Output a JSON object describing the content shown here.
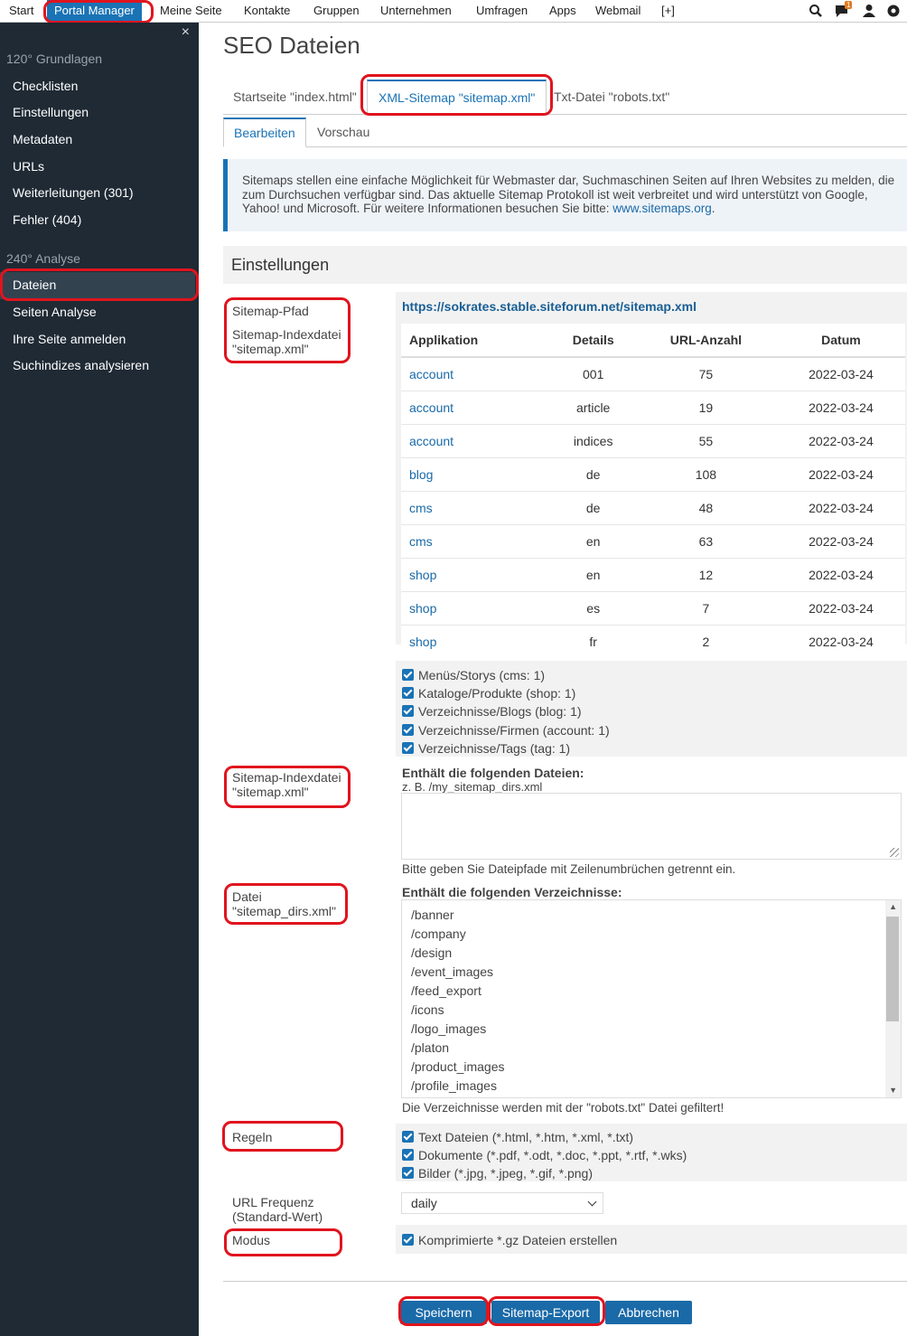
{
  "topnav": {
    "items": [
      "Start",
      "Portal Manager",
      "Meine Seite",
      "Kontakte",
      "Gruppen",
      "Unternehmen",
      "Umfragen",
      "Apps",
      "Webmail",
      "[+]"
    ],
    "notification_count": "1",
    "icons": [
      "search-zoom-icon",
      "chat-icon",
      "user-icon",
      "settings-gear-icon"
    ]
  },
  "sidebar": {
    "close": "×",
    "group1": "120° Grundlagen",
    "group1_items": [
      "Checklisten",
      "Einstellungen",
      "Metadaten",
      "URLs",
      "Weiterleitungen (301)",
      "Fehler (404)"
    ],
    "group2": "240° Analyse",
    "group2_items": [
      "Dateien",
      "Seiten Analyse",
      "Ihre Seite anmelden",
      "Suchindizes analysieren"
    ]
  },
  "page": {
    "title": "SEO Dateien",
    "tabs": [
      "Startseite \"index.html\"",
      "XML-Sitemap \"sitemap.xml\"",
      "Txt-Datei \"robots.txt\""
    ],
    "subtabs": [
      "Bearbeiten",
      "Vorschau"
    ],
    "info_text": "Sitemaps stellen eine einfache Möglichkeit für Webmaster dar, Suchmaschinen Seiten auf Ihren Websites zu melden, die zum Durchsuchen verfügbar sind. Das aktuelle Sitemap Protokoll ist weit verbreitet und wird unterstützt von Google, Yahoo! und Microsoft. Für weitere Informationen besuchen Sie bitte: ",
    "info_link": "www.sitemaps.org",
    "info_end": ".",
    "section_title": "Einstellungen"
  },
  "labels": {
    "sitemap_path": "Sitemap-Pfad",
    "sitemap_index_1": "Sitemap-Indexdatei \"sitemap.xml\"",
    "sitemap_index_2": "Sitemap-Indexdatei \"sitemap.xml\"",
    "file_dirs": "Datei \"sitemap_dirs.xml\"",
    "rules": "Regeln",
    "url_freq": "URL Frequenz (Standard-Wert)",
    "mode": "Modus"
  },
  "sitemap": {
    "url": "https://sokrates.stable.siteforum.net/sitemap.xml",
    "columns": [
      "Applikation",
      "Details",
      "URL-Anzahl",
      "Datum"
    ],
    "rows": [
      [
        "account",
        "001",
        "75",
        "2022-03-24"
      ],
      [
        "account",
        "article",
        "19",
        "2022-03-24"
      ],
      [
        "account",
        "indices",
        "55",
        "2022-03-24"
      ],
      [
        "blog",
        "de",
        "108",
        "2022-03-24"
      ],
      [
        "cms",
        "de",
        "48",
        "2022-03-24"
      ],
      [
        "cms",
        "en",
        "63",
        "2022-03-24"
      ],
      [
        "shop",
        "en",
        "12",
        "2022-03-24"
      ],
      [
        "shop",
        "es",
        "7",
        "2022-03-24"
      ],
      [
        "shop",
        "fr",
        "2",
        "2022-03-24"
      ]
    ]
  },
  "index_options": [
    "Menüs/Storys (cms: 1)",
    "Kataloge/Produkte (shop: 1)",
    "Verzeichnisse/Blogs (blog: 1)",
    "Verzeichnisse/Firmen (account: 1)",
    "Verzeichnisse/Tags (tag: 1)"
  ],
  "files": {
    "heading": "Enthält die folgenden Dateien:",
    "placeholder": "z. B. /my_sitemap_dirs.xml",
    "hint": "Bitte geben Sie Dateipfade mit Zeilenumbrüchen getrennt ein."
  },
  "dirs": {
    "heading": "Enthält die folgenden Verzeichnisse:",
    "items": [
      "/banner",
      "/company",
      "/design",
      "/event_images",
      "/feed_export",
      "/icons",
      "/logo_images",
      "/platon",
      "/product_images",
      "/profile_images"
    ],
    "hint": "Die Verzeichnisse werden mit der \"robots.txt\" Datei gefiltert!"
  },
  "rules": [
    "Text Dateien (*.html, *.htm, *.xml, *.txt)",
    "Dokumente (*.pdf, *.odt, *.doc, *.ppt, *.rtf, *.wks)",
    "Bilder (*.jpg, *.jpeg, *.gif, *.png)"
  ],
  "url_freq_value": "daily",
  "mode_option": "Komprimierte *.gz Dateien erstellen",
  "buttons": {
    "save": "Speichern",
    "export": "Sitemap-Export",
    "cancel": "Abbrechen"
  },
  "colors": {
    "accent": "#1a73b5",
    "sidebar_bg": "#1f2a34",
    "highlight": "#e0141e"
  }
}
